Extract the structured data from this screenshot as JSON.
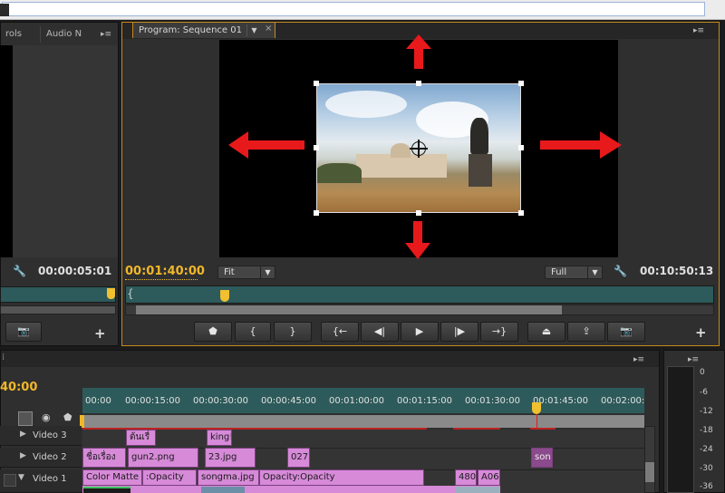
{
  "source_monitor": {
    "tabs": [
      "rols",
      "Audio N"
    ],
    "timecode": "00:00:05:01"
  },
  "program_monitor": {
    "tab_label": "Program: Sequence 01",
    "current_time": "00:01:40:00",
    "duration": "00:10:50:13",
    "zoom_select": "Fit",
    "quality_select": "Full"
  },
  "timeline": {
    "timecode": "40:00",
    "ruler_labels": [
      "00:00",
      "00:00:15:00",
      "00:00:30:00",
      "00:00:45:00",
      "00:01:00:00",
      "00:01:15:00",
      "00:01:30:00",
      "00:01:45:00",
      "00:02:00:"
    ],
    "tracks": [
      {
        "name": "Video 3",
        "clips": [
          "ต้นเรื่",
          "king!"
        ]
      },
      {
        "name": "Video 2",
        "clips": [
          "ชื่อเรื่อง",
          "gun2.png",
          "23.jpg",
          "027",
          "son"
        ]
      },
      {
        "name": "Video 1",
        "clips": [
          "Color Matte",
          ":Opacity",
          "songma.jpg",
          "Opacity:Opacity",
          "480",
          "A06"
        ]
      }
    ]
  },
  "audio_meter": {
    "db_labels": [
      "0",
      "-6",
      "-12",
      "-18",
      "-24",
      "-30",
      "-36"
    ]
  },
  "colors": {
    "accent_timecode": "#f0b72a",
    "clip_pink": "#d68ad8",
    "arrow_red": "#e8191b",
    "teal_bar": "#2d5a5a"
  }
}
